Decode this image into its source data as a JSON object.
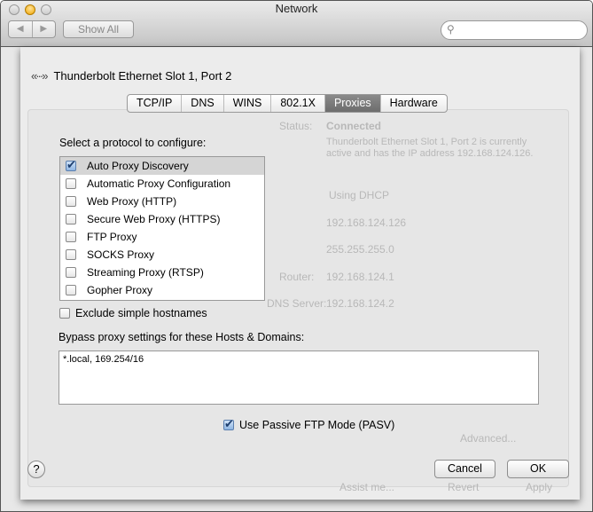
{
  "window": {
    "title": "Network",
    "show_all": "Show All",
    "search_placeholder": "",
    "search_icon": "magnifier-icon"
  },
  "background": {
    "status_label": "Status:",
    "status_value": "Connected",
    "description": "Thunderbolt Ethernet Slot 1, Port 2 is currently active and has the IP address 192.168.124.126.",
    "configure_value": "Using DHCP",
    "ip_value": "192.168.124.126",
    "subnet_value": "255.255.255.0",
    "router_label": "Router:",
    "router_value": "192.168.124.1",
    "dns_label": "DNS Server:",
    "dns_value": "192.168.124.2",
    "advanced": "Advanced...",
    "assist": "Assist me...",
    "revert": "Revert",
    "apply": "Apply"
  },
  "sheet": {
    "service_name": "Thunderbolt Ethernet Slot 1, Port 2",
    "service_icon": "ethernet-icon",
    "tabs": [
      {
        "label": "TCP/IP"
      },
      {
        "label": "DNS"
      },
      {
        "label": "WINS"
      },
      {
        "label": "802.1X"
      },
      {
        "label": "Proxies",
        "active": true
      },
      {
        "label": "Hardware"
      }
    ],
    "protocol_prompt": "Select a protocol to configure:",
    "protocols": [
      {
        "label": "Auto Proxy Discovery",
        "checked": true
      },
      {
        "label": "Automatic Proxy Configuration",
        "checked": false
      },
      {
        "label": "Web Proxy (HTTP)",
        "checked": false
      },
      {
        "label": "Secure Web Proxy (HTTPS)",
        "checked": false
      },
      {
        "label": "FTP Proxy",
        "checked": false
      },
      {
        "label": "SOCKS Proxy",
        "checked": false
      },
      {
        "label": "Streaming Proxy (RTSP)",
        "checked": false
      },
      {
        "label": "Gopher Proxy",
        "checked": false
      }
    ],
    "exclude_simple": {
      "label": "Exclude simple hostnames",
      "checked": false
    },
    "bypass_label": "Bypass proxy settings for these Hosts & Domains:",
    "bypass_value": "*.local, 169.254/16",
    "passive_ftp": {
      "label": "Use Passive FTP Mode (PASV)",
      "checked": true
    },
    "help": "?",
    "cancel": "Cancel",
    "ok": "OK"
  }
}
